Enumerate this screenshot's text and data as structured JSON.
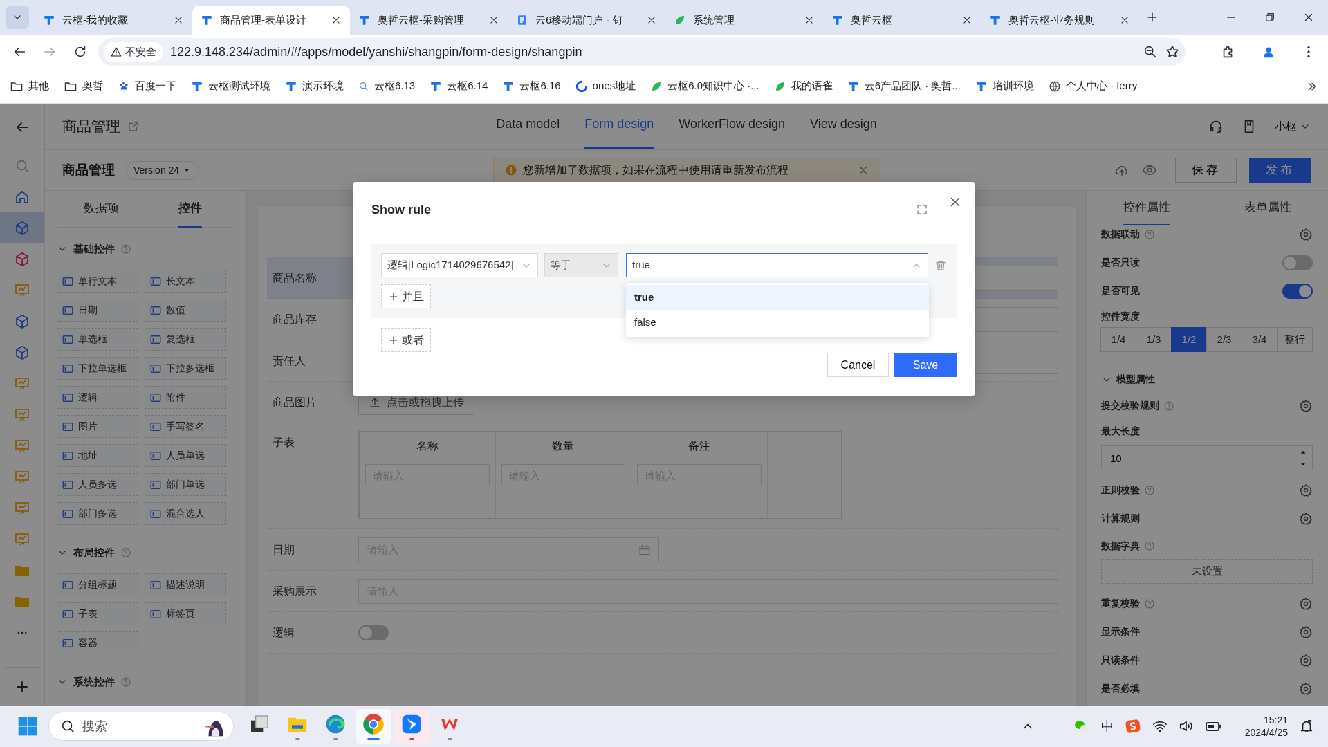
{
  "browser": {
    "tabs": [
      {
        "kind": "logo",
        "title": "云枢-我的收藏",
        "selected": false
      },
      {
        "kind": "logo",
        "title": "商品管理-表单设计",
        "selected": true
      },
      {
        "kind": "logo",
        "title": "奥哲云枢-采购管理",
        "selected": false
      },
      {
        "kind": "doc",
        "title": "云6移动端门户 · 钉",
        "selected": false
      },
      {
        "kind": "leaf",
        "title": "系统管理",
        "selected": false
      },
      {
        "kind": "logo",
        "title": "奥哲云枢",
        "selected": false
      },
      {
        "kind": "logo",
        "title": "奥哲云枢-业务规则",
        "selected": false
      }
    ],
    "address": {
      "security": "不安全",
      "url": "122.9.148.234/admin/#/apps/model/yanshi/shangpin/form-design/shangpin"
    },
    "bookmarks": [
      {
        "kind": "folder",
        "label": "其他"
      },
      {
        "kind": "folder",
        "label": "奥哲"
      },
      {
        "kind": "paw",
        "label": "百度一下"
      },
      {
        "kind": "logo",
        "label": "云枢测试环境"
      },
      {
        "kind": "logo",
        "label": "演示环境"
      },
      {
        "kind": "search",
        "label": "云枢6.13"
      },
      {
        "kind": "logo",
        "label": "云枢6.14"
      },
      {
        "kind": "logo",
        "label": "云枢6.16"
      },
      {
        "kind": "swirl",
        "label": "ones地址"
      },
      {
        "kind": "leaf",
        "label": "云枢6.0知识中心 ·..."
      },
      {
        "kind": "leaf",
        "label": "我的语雀"
      },
      {
        "kind": "logo",
        "label": "云6产品团队 · 奥哲..."
      },
      {
        "kind": "logo",
        "label": "培训环境"
      },
      {
        "kind": "globe",
        "label": "个人中心 - ferry"
      }
    ]
  },
  "app": {
    "header": {
      "title": "商品管理",
      "nav": [
        {
          "label": "Data model",
          "selected": false
        },
        {
          "label": "Form design",
          "selected": true
        },
        {
          "label": "WorkerFlow design",
          "selected": false
        },
        {
          "label": "View design",
          "selected": false
        }
      ],
      "user": "小枢"
    },
    "toolbar": {
      "title": "商品管理",
      "version": "Version 24",
      "alert": "您新增加了数据项，如果在流程中使用请重新发布流程",
      "save": "保存",
      "publish": "发布"
    },
    "rail": [
      {
        "kind": "home",
        "selected": false
      },
      {
        "kind": "cube",
        "selected": true
      },
      {
        "kind": "package",
        "selected": false
      },
      {
        "kind": "board",
        "selected": false
      },
      {
        "kind": "cube",
        "selected": false
      },
      {
        "kind": "cube",
        "selected": false
      },
      {
        "kind": "board",
        "selected": false
      },
      {
        "kind": "board",
        "selected": false
      },
      {
        "kind": "board",
        "selected": false
      },
      {
        "kind": "board",
        "selected": false
      },
      {
        "kind": "board",
        "selected": false
      },
      {
        "kind": "board",
        "selected": false
      },
      {
        "kind": "folder",
        "selected": false
      },
      {
        "kind": "folder",
        "selected": false
      }
    ],
    "widgets": {
      "tabs": [
        {
          "label": "数据项",
          "selected": false
        },
        {
          "label": "控件",
          "selected": true
        }
      ],
      "groups": [
        {
          "title": "基础控件",
          "expanded": true,
          "items": [
            "单行文本",
            "长文本",
            "日期",
            "数值",
            "单选框",
            "复选框",
            "下拉单选框",
            "下拉多选框",
            "逻辑",
            "附件",
            "图片",
            "手写签名",
            "地址",
            "人员单选",
            "人员多选",
            "部门单选",
            "部门多选",
            "混合选人"
          ]
        },
        {
          "title": "布局控件",
          "expanded": true,
          "items": [
            "分组标题",
            "描述说明",
            "子表",
            "标签页",
            "容器"
          ]
        },
        {
          "title": "系统控件",
          "expanded": true
        }
      ]
    },
    "form": {
      "fields": [
        {
          "kind": "input",
          "label": "商品名称",
          "selected": true
        },
        {
          "kind": "input",
          "label": "商品库存",
          "selected": false
        },
        {
          "kind": "input",
          "label": "责任人",
          "selected": false
        },
        {
          "kind": "upload",
          "label": "商品图片",
          "button": "点击或拖拽上传",
          "selected": false
        },
        {
          "kind": "table",
          "label": "子表",
          "columns": [
            "名称",
            "数量",
            "备注"
          ],
          "placeholders": [
            "请输入",
            "请输入",
            "请输入"
          ],
          "selected": false
        },
        {
          "kind": "date",
          "label": "日期",
          "placeholder": "请输入",
          "selected": false
        },
        {
          "kind": "input",
          "label": "采购展示",
          "placeholder": "请输入",
          "selected": false
        },
        {
          "kind": "switch",
          "label": "逻辑",
          "on": false,
          "selected": false
        }
      ]
    },
    "properties": {
      "tabs": [
        {
          "label": "控件属性",
          "selected": true
        },
        {
          "label": "表单属性",
          "selected": false
        }
      ],
      "items": [
        {
          "kind": "setting",
          "label": "数据联动",
          "help": true
        },
        {
          "kind": "switch",
          "label": "是否只读",
          "on": false
        },
        {
          "kind": "switch",
          "label": "是否可见",
          "on": true
        },
        {
          "kind": "segments",
          "label": "控件宽度",
          "options": [
            {
              "label": "1/4",
              "selected": false
            },
            {
              "label": "1/3",
              "selected": false
            },
            {
              "label": "1/2",
              "selected": true
            },
            {
              "label": "2/3",
              "selected": false
            },
            {
              "label": "3/4",
              "selected": false
            },
            {
              "label": "整行",
              "selected": false
            }
          ]
        },
        {
          "kind": "section",
          "label": "模型属性",
          "expanded": true
        },
        {
          "kind": "setting",
          "label": "提交校验规则",
          "help": true
        },
        {
          "kind": "number",
          "label": "最大长度",
          "value": "10"
        },
        {
          "kind": "setting",
          "label": "正则校验",
          "help": true
        },
        {
          "kind": "setting",
          "label": "计算规则",
          "help": false
        },
        {
          "kind": "dictionary",
          "label": "数据字典",
          "help": true,
          "button": "未设置"
        },
        {
          "kind": "setting",
          "label": "重复校验",
          "help": true
        },
        {
          "kind": "setting",
          "label": "显示条件",
          "help": false
        },
        {
          "kind": "setting",
          "label": "只读条件",
          "help": false
        },
        {
          "kind": "setting",
          "label": "是否必填",
          "help": false
        }
      ]
    }
  },
  "dialog": {
    "title": "Show rule",
    "field": "逻辑[Logic1714029676542]",
    "operator": {
      "text": "等于",
      "disabled": true
    },
    "value": "true",
    "open": true,
    "options": [
      {
        "label": "true",
        "selected": true
      },
      {
        "label": "false",
        "selected": false
      }
    ],
    "and_button": "并且",
    "or_button": "或者",
    "cancel": "Cancel",
    "save": "Save"
  },
  "taskbar": {
    "search": "搜索",
    "apps": [
      {
        "kind": "taskview",
        "running": false,
        "active": false,
        "notify": false
      },
      {
        "kind": "explorer",
        "running": true,
        "active": false,
        "notify": false
      },
      {
        "kind": "edge",
        "running": true,
        "active": false,
        "notify": false
      },
      {
        "kind": "chrome",
        "running": true,
        "active": true,
        "notify": false
      },
      {
        "kind": "feishu",
        "running": true,
        "active": true,
        "notify": true
      },
      {
        "kind": "wps",
        "running": true,
        "active": false,
        "notify": false
      }
    ],
    "ime": "中",
    "time": "15:21",
    "date": "2024/4/25"
  }
}
